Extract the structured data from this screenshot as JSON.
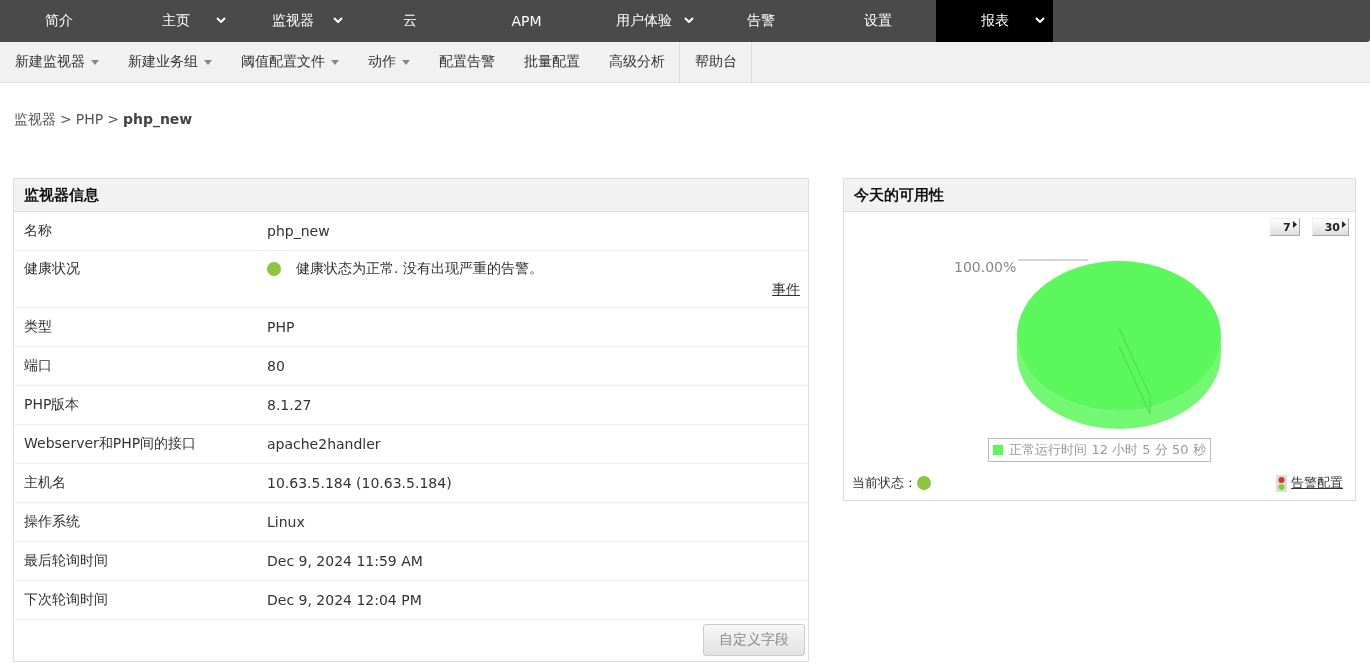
{
  "top_nav": [
    {
      "label": "简介",
      "dropdown": false,
      "selected": false
    },
    {
      "label": "主页",
      "dropdown": true,
      "selected": false
    },
    {
      "label": "监视器",
      "dropdown": true,
      "selected": false
    },
    {
      "label": "云",
      "dropdown": false,
      "selected": false
    },
    {
      "label": "APM",
      "dropdown": false,
      "selected": false
    },
    {
      "label": "用户体验",
      "dropdown": true,
      "selected": false
    },
    {
      "label": "告警",
      "dropdown": false,
      "selected": false
    },
    {
      "label": "设置",
      "dropdown": false,
      "selected": false
    },
    {
      "label": "报表",
      "dropdown": true,
      "selected": true
    }
  ],
  "sub_nav": [
    {
      "label": "新建监视器",
      "dropdown": true
    },
    {
      "label": "新建业务组",
      "dropdown": true
    },
    {
      "label": "阈值配置文件",
      "dropdown": true
    },
    {
      "label": "动作",
      "dropdown": true
    },
    {
      "label": "配置告警",
      "dropdown": false
    },
    {
      "label": "批量配置",
      "dropdown": false
    },
    {
      "label": "高级分析",
      "dropdown": false
    },
    {
      "label": "帮助台",
      "dropdown": false
    }
  ],
  "breadcrumb": {
    "links": [
      "监视器",
      "PHP"
    ],
    "separator": ">",
    "current": "php_new"
  },
  "monitor_info": {
    "title": "监视器信息",
    "rows": [
      {
        "kind": "text",
        "label": "名称",
        "value": "php_new"
      },
      {
        "kind": "health",
        "label": "健康状况",
        "value": "健康状态为正常. 没有出现严重的告警。",
        "healthy": true,
        "link": "事件"
      },
      {
        "kind": "text",
        "label": "类型",
        "value": "PHP"
      },
      {
        "kind": "text",
        "label": "端口",
        "value": "80"
      },
      {
        "kind": "text",
        "label": "PHP版本",
        "value": "8.1.27"
      },
      {
        "kind": "text",
        "label": "Webserver和PHP间的接口",
        "value": "apache2handler"
      },
      {
        "kind": "text",
        "label": "主机名",
        "value": "10.63.5.184 (10.63.5.184)"
      },
      {
        "kind": "text",
        "label": "操作系统",
        "value": "Linux"
      },
      {
        "kind": "text",
        "label": "最后轮询时间",
        "value": "Dec 9, 2024 11:59 AM"
      },
      {
        "kind": "text",
        "label": "下次轮询时间",
        "value": "Dec 9, 2024 12:04 PM"
      }
    ],
    "button": "自定义字段"
  },
  "availability": {
    "title": "今天的可用性",
    "range_buttons": [
      "7",
      "30"
    ],
    "chart_data": {
      "type": "pie",
      "categories": [
        "正常运行时间 12 小时 5 分 50 秒"
      ],
      "value_labels": [
        "100.00%"
      ]
    },
    "current_status_label": "当前状态 :",
    "current_healthy": true,
    "alarm_link": "告警配置"
  }
}
